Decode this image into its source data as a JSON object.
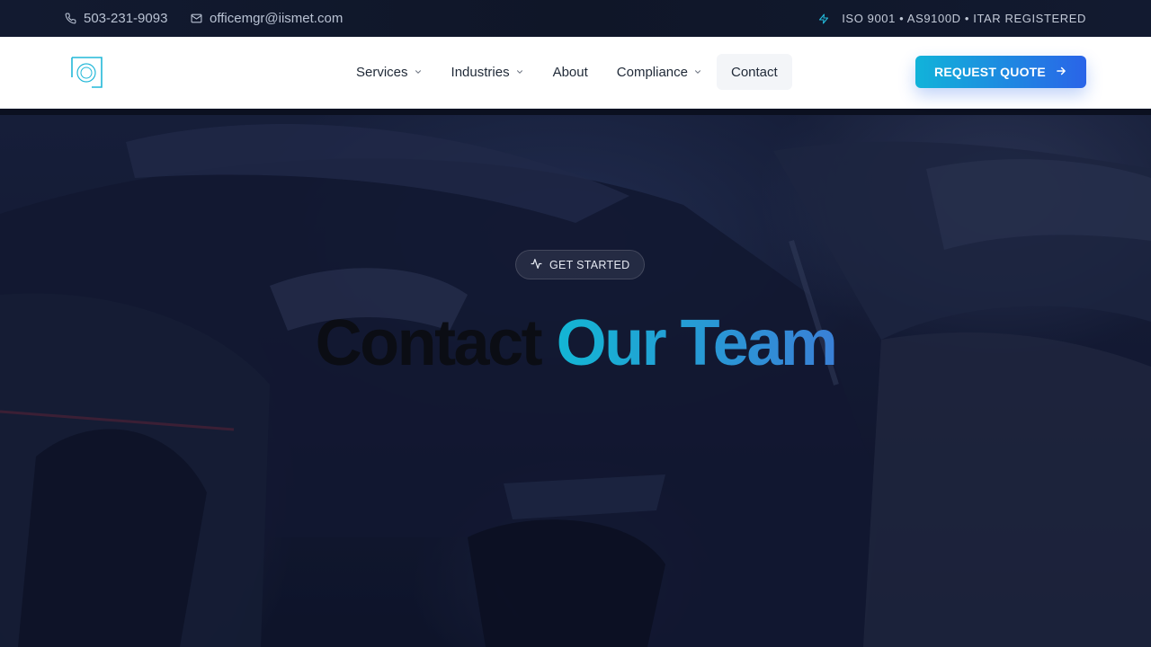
{
  "topbar": {
    "phone": "503-231-9093",
    "email": "officemgr@iismet.com",
    "certifications": "ISO 9001 • AS9100D • ITAR REGISTERED",
    "icons": {
      "phone": "phone-icon",
      "email": "mail-icon",
      "cert": "lightning-icon"
    }
  },
  "nav": {
    "logo": "logo-mark",
    "items": [
      {
        "label": "Services",
        "has_dropdown": true
      },
      {
        "label": "Industries",
        "has_dropdown": true
      },
      {
        "label": "About",
        "has_dropdown": false
      },
      {
        "label": "Compliance",
        "has_dropdown": true
      },
      {
        "label": "Contact",
        "has_dropdown": false,
        "active": true
      }
    ],
    "cta_label": "REQUEST QUOTE",
    "cta_icon": "arrow-right-icon"
  },
  "hero": {
    "badge_label": "GET STARTED",
    "badge_icon": "activity-icon",
    "title_part1": "Contact",
    "title_part2": "Our Team",
    "background": "dark photo of parked cars with headlights"
  },
  "colors": {
    "accent_start": "#11b3d9",
    "accent_end": "#2a64e8",
    "topbar_bg": "#121a30",
    "nav_bg": "#ffffff",
    "hero_overlay": "#0d142d"
  }
}
